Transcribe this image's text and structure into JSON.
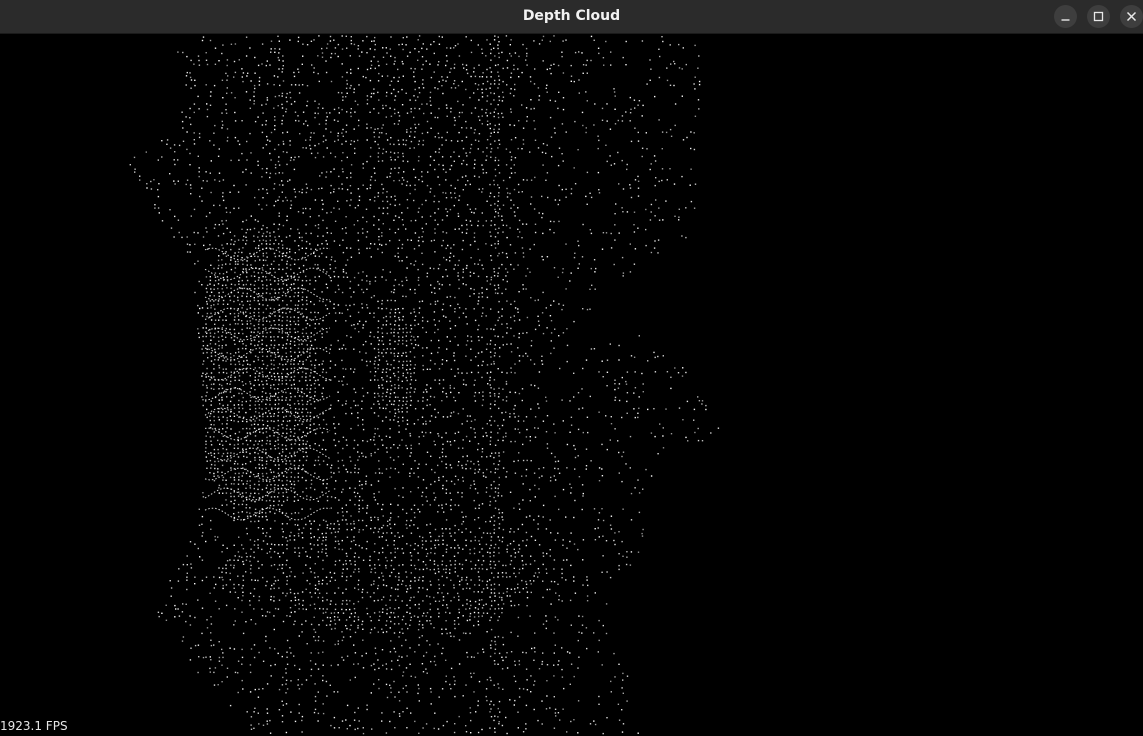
{
  "window": {
    "title": "Depth Cloud",
    "buttons": {
      "minimize_icon": "minimize-icon",
      "maximize_icon": "maximize-icon",
      "close_icon": "close-icon"
    }
  },
  "viewport": {
    "background_color": "#000000",
    "point_color": "#ffffff",
    "fps_text": "1923.1 FPS"
  }
}
